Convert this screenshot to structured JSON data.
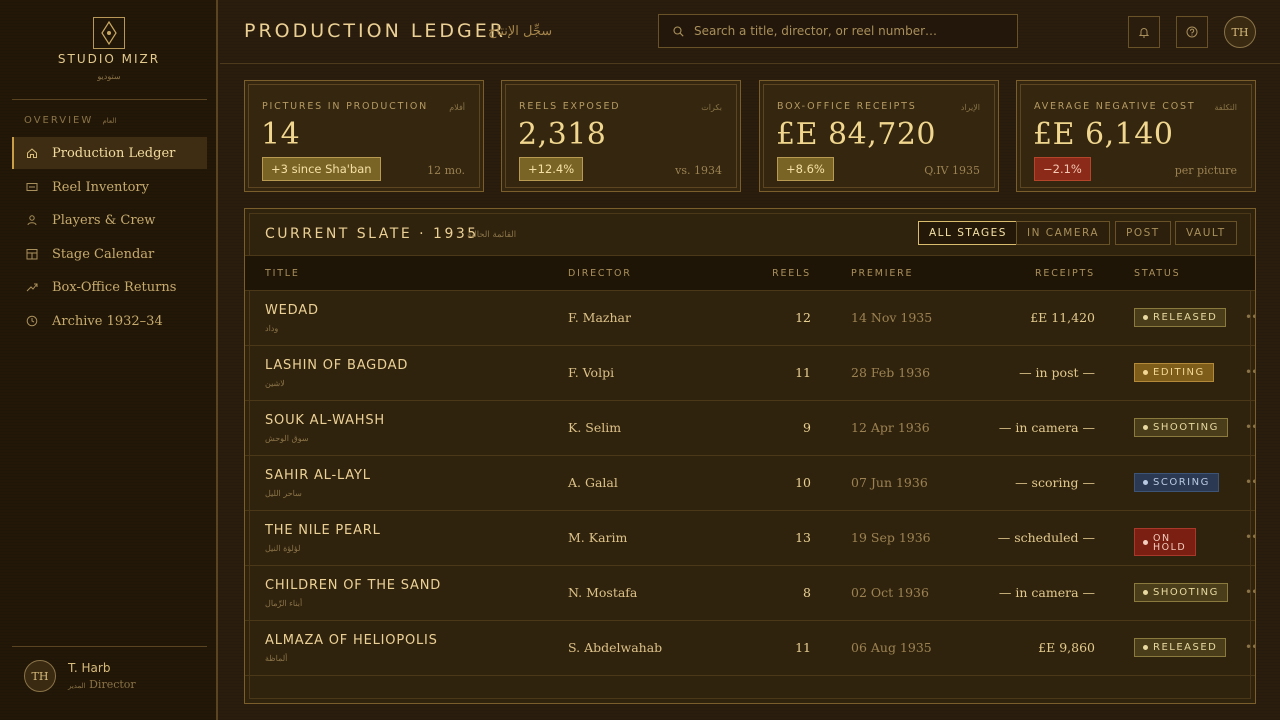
{
  "sidebar": {
    "brand": "STUDIO MIZR",
    "brand_ar": "ستوديو",
    "section_label": "OVERVIEW",
    "section_label_ar": "العام",
    "items": [
      {
        "label": "Production Ledger",
        "icon": "home-icon",
        "active": true
      },
      {
        "label": "Reel Inventory",
        "icon": "film-reel-icon"
      },
      {
        "label": "Players & Crew",
        "icon": "person-icon"
      },
      {
        "label": "Stage Calendar",
        "icon": "calendar-icon"
      },
      {
        "label": "Box-Office Returns",
        "icon": "trend-icon"
      },
      {
        "label": "Archive 1932–34",
        "icon": "clock-icon"
      }
    ],
    "user": {
      "initials": "TH",
      "name": "T. Harb",
      "role": "Director",
      "role_ar": "المدير"
    }
  },
  "header": {
    "title": "PRODUCTION LEDGER",
    "title_ar": "سجِّل الإنتاج",
    "search_placeholder": "Search a title, director, or reel number…",
    "avatar_initials": "TH"
  },
  "kpis": [
    {
      "label": "PICTURES IN PRODUCTION",
      "label_ar": "أفلام",
      "value": "14",
      "badge": "+3 since Sha'ban",
      "badge_type": "pos",
      "note": "12 mo."
    },
    {
      "label": "REELS EXPOSED",
      "label_ar": "بكرات",
      "value": "2,318",
      "badge": "+12.4%",
      "badge_type": "pos",
      "note": "vs. 1934"
    },
    {
      "label": "BOX-OFFICE RECEIPTS",
      "label_ar": "الإيراد",
      "value": "£E 84,720",
      "badge": "+8.6%",
      "badge_type": "pos",
      "note": "Q.IV 1935"
    },
    {
      "label": "AVERAGE NEGATIVE COST",
      "label_ar": "التكلفة",
      "value": "£E 6,140",
      "badge": "−2.1%",
      "badge_type": "neg",
      "note": "per picture"
    }
  ],
  "slate": {
    "title": "CURRENT SLATE · 1935",
    "title_ar": "القائمة الحالية",
    "filters": [
      "ALL STAGES",
      "IN CAMERA",
      "POST",
      "VAULT"
    ],
    "active_filter": "ALL STAGES",
    "columns": {
      "title": "TITLE",
      "director": "DIRECTOR",
      "reels": "REELS",
      "premiere": "PREMIERE",
      "receipts": "RECEIPTS",
      "status": "STATUS"
    },
    "rows": [
      {
        "title": "WEDAD",
        "title_ar": "وداد",
        "director": "F. Mazhar",
        "reels": "12",
        "premiere": "14 Nov 1935",
        "receipts": "£E 11,420",
        "status": "RELEASED",
        "status_class": "released"
      },
      {
        "title": "LASHIN OF BAGDAD",
        "title_ar": "لاشين",
        "director": "F. Volpi",
        "reels": "11",
        "premiere": "28 Feb 1936",
        "receipts": "— in post —",
        "status": "EDITING",
        "status_class": "editing"
      },
      {
        "title": "SOUK AL-WAHSH",
        "title_ar": "سوق الوحش",
        "director": "K. Selim",
        "reels": "9",
        "premiere": "12 Apr 1936",
        "receipts": "— in camera —",
        "status": "SHOOTING",
        "status_class": "shooting"
      },
      {
        "title": "SAHIR AL-LAYL",
        "title_ar": "ساحر الليل",
        "director": "A. Galal",
        "reels": "10",
        "premiere": "07 Jun 1936",
        "receipts": "— scoring —",
        "status": "SCORING",
        "status_class": "scoring"
      },
      {
        "title": "THE NILE PEARL",
        "title_ar": "لؤلؤة النيل",
        "director": "M. Karim",
        "reels": "13",
        "premiere": "19 Sep 1936",
        "receipts": "— scheduled —",
        "status": "ON HOLD",
        "status_class": "onhold"
      },
      {
        "title": "CHILDREN OF THE SAND",
        "title_ar": "أبناء الرِّمال",
        "director": "N. Mostafa",
        "reels": "8",
        "premiere": "02 Oct 1936",
        "receipts": "— in camera —",
        "status": "SHOOTING",
        "status_class": "shooting"
      },
      {
        "title": "ALMAZA OF HELIOPOLIS",
        "title_ar": "ألماظة",
        "director": "S. Abdelwahab",
        "reels": "11",
        "premiere": "06 Aug 1935",
        "receipts": "£E 9,860",
        "status": "RELEASED",
        "status_class": "released"
      }
    ]
  }
}
